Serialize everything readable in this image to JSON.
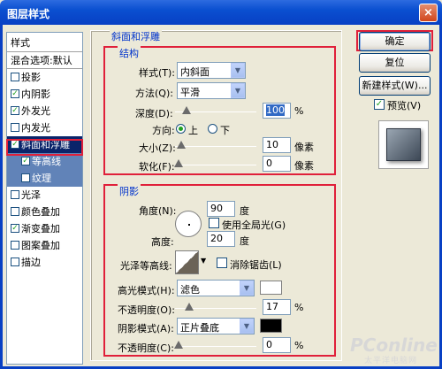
{
  "window": {
    "title": "图层样式",
    "close_symbol": "×"
  },
  "styles_panel": {
    "header": "样式",
    "blend_options": "混合选项:默认",
    "items": [
      {
        "label": "投影",
        "checked": false
      },
      {
        "label": "内阴影",
        "checked": true
      },
      {
        "label": "外发光",
        "checked": true
      },
      {
        "label": "内发光",
        "checked": false
      },
      {
        "label": "斜面和浮雕",
        "checked": true,
        "selected": true
      },
      {
        "label": "等高线",
        "checked": true,
        "sub": true
      },
      {
        "label": "纹理",
        "checked": false,
        "sub": true
      },
      {
        "label": "光泽",
        "checked": false
      },
      {
        "label": "颜色叠加",
        "checked": false
      },
      {
        "label": "渐变叠加",
        "checked": true
      },
      {
        "label": "图案叠加",
        "checked": false
      },
      {
        "label": "描边",
        "checked": false
      }
    ]
  },
  "bevel": {
    "title": "斜面和浮雕",
    "structure": {
      "title": "结构",
      "style_label": "样式(T):",
      "style_value": "内斜面",
      "technique_label": "方法(Q):",
      "technique_value": "平滑",
      "depth_label": "深度(D):",
      "depth_value": "100",
      "depth_unit": "%",
      "direction_label": "方向:",
      "direction_up": "上",
      "direction_down": "下",
      "direction_selected": "up",
      "size_label": "大小(Z):",
      "size_value": "10",
      "size_unit": "像素",
      "soften_label": "软化(F):",
      "soften_value": "0",
      "soften_unit": "像素"
    },
    "shading": {
      "title": "阴影",
      "angle_label": "角度(N):",
      "angle_value": "90",
      "angle_unit": "度",
      "global_light_label": "使用全局光(G)",
      "global_light_checked": false,
      "altitude_label": "高度:",
      "altitude_value": "20",
      "altitude_unit": "度",
      "gloss_label": "光泽等高线:",
      "antialias_label": "消除锯齿(L)",
      "antialias_checked": false,
      "highlight_mode_label": "高光模式(H):",
      "highlight_mode_value": "滤色",
      "highlight_color": "#ffffff",
      "highlight_opacity_label": "不透明度(O):",
      "highlight_opacity_value": "17",
      "highlight_opacity_unit": "%",
      "shadow_mode_label": "阴影模式(A):",
      "shadow_mode_value": "正片叠底",
      "shadow_color": "#000000",
      "shadow_opacity_label": "不透明度(C):",
      "shadow_opacity_value": "0",
      "shadow_opacity_unit": "%"
    }
  },
  "buttons": {
    "ok": "确定",
    "reset": "复位",
    "new_style": "新建样式(W)...",
    "preview": "预览(V)",
    "preview_checked": true
  },
  "watermark": {
    "brand": "PConline",
    "sub": "太平洋电脑网"
  },
  "icons": {
    "dropdown": "chevron-down-icon",
    "check": "✓"
  }
}
